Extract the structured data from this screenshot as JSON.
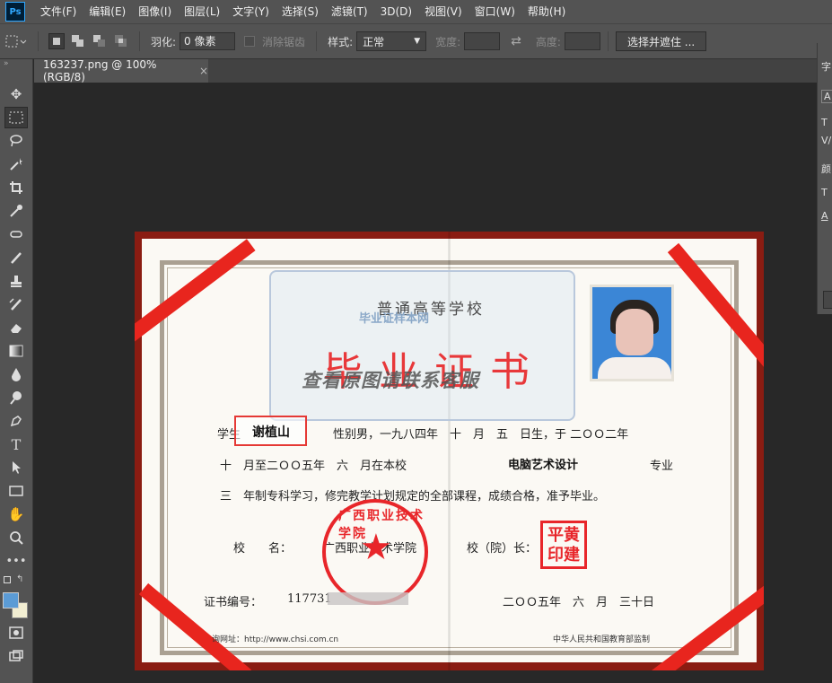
{
  "app": {
    "logo": "Ps"
  },
  "menu": [
    "文件(F)",
    "编辑(E)",
    "图像(I)",
    "图层(L)",
    "文字(Y)",
    "选择(S)",
    "滤镜(T)",
    "3D(D)",
    "视图(V)",
    "窗口(W)",
    "帮助(H)"
  ],
  "options": {
    "feather_label": "羽化:",
    "feather_value": "0 像素",
    "antialias_label": "消除锯齿",
    "style_label": "样式:",
    "style_value": "正常",
    "width_label": "宽度:",
    "height_label": "高度:",
    "mask_button": "选择并遮住 ..."
  },
  "tab": {
    "title": "163237.png @ 100%(RGB/8)",
    "close": "×"
  },
  "tools": [
    "move-tool",
    "marquee-tool",
    "lasso-tool",
    "magic-wand-tool",
    "crop-tool",
    "eyedropper-tool",
    "healing-tool",
    "brush-tool",
    "stamp-tool",
    "history-brush-tool",
    "eraser-tool",
    "gradient-tool",
    "blur-tool",
    "dodge-tool",
    "pen-tool",
    "type-tool",
    "path-selection-tool",
    "rectangle-tool",
    "hand-tool",
    "zoom-tool",
    "more-tools"
  ],
  "colors": {
    "foreground": "#5b9bd5",
    "background": "#f2eed2",
    "accent": "#e53935"
  },
  "certificate": {
    "school_type": "普通高等学校",
    "watermark_small": "毕业证样本网",
    "title": "毕业证书",
    "watermark": "查看原图请联系客服",
    "line1_student": "学生",
    "name": "谢植山",
    "line1_rest": "性别男，一九八四年　十　月　五　日生，于 二ＯＯ二年",
    "line2": "十　月至二ＯＯ五年　六　月在本校",
    "major": "电脑艺术设计",
    "major_suffix": "专业",
    "line3": "三　年制专科学习，修完教学计划规定的全部课程，成绩合格，准予毕业。",
    "school_label": "校　　名：",
    "school_name": "广西职业技术学院",
    "president_label": "校（院）长：",
    "seal_text": "广西职业技术学院",
    "stamp_text": "平黄印建",
    "cert_no_label": "证书编号：",
    "cert_no": "117731",
    "date": "二ＯＯ五年　六　月　三十日",
    "footer_left": "询网址：http://www.chsi.com.cn",
    "footer_right": "中华人民共和国教育部监制"
  },
  "right_panel": [
    "字",
    "A",
    "T",
    "V/",
    "颜",
    "T",
    "A"
  ]
}
